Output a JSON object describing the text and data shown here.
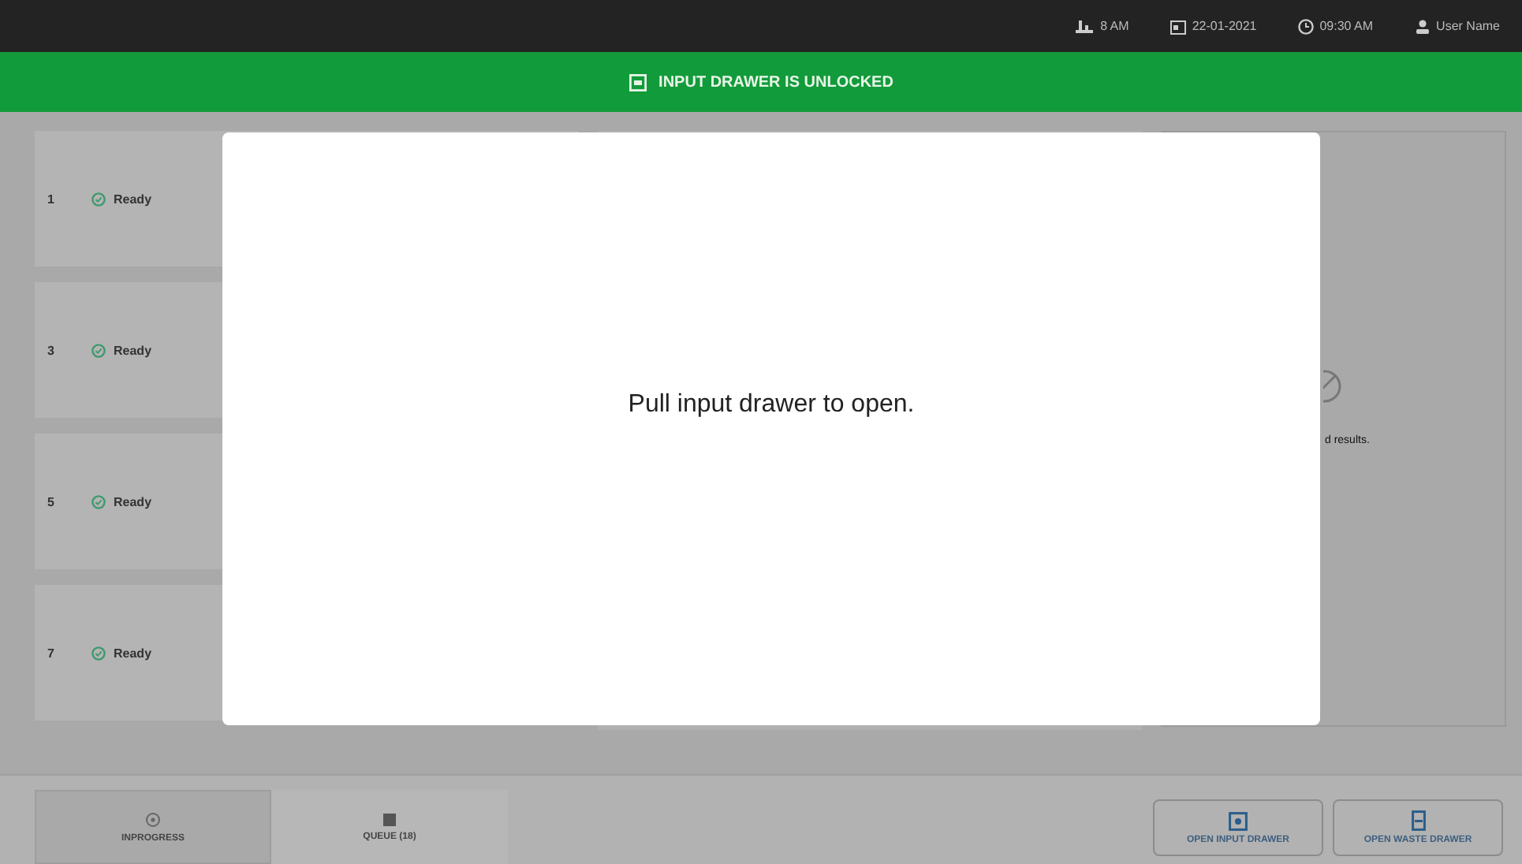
{
  "status_bar": {
    "items": [
      {
        "kind": "temperature",
        "text": "8 AM"
      },
      {
        "kind": "date",
        "text": "22-01-2021"
      },
      {
        "kind": "time",
        "text": "09:30 AM"
      },
      {
        "kind": "user",
        "text": "User Name"
      }
    ]
  },
  "banner": {
    "text": "INPUT DRAWER IS UNLOCKED"
  },
  "slots": [
    {
      "number": "1",
      "status": "Ready"
    },
    {
      "number": "3",
      "status": "Ready"
    },
    {
      "number": "5",
      "status": "Ready"
    },
    {
      "number": "7",
      "status": "Ready"
    }
  ],
  "results_panel": {
    "text": "d results."
  },
  "dialog": {
    "message": "Pull input drawer to open."
  },
  "tabs": [
    {
      "label": "INPROGRESS",
      "kind": "progress",
      "selected": true
    },
    {
      "label": "QUEUE (18)",
      "kind": "queue",
      "selected": false
    }
  ],
  "buttons": [
    {
      "label": "OPEN INPUT DRAWER",
      "kind": "input"
    },
    {
      "label": "OPEN WASTE DRAWER",
      "kind": "waste"
    }
  ]
}
